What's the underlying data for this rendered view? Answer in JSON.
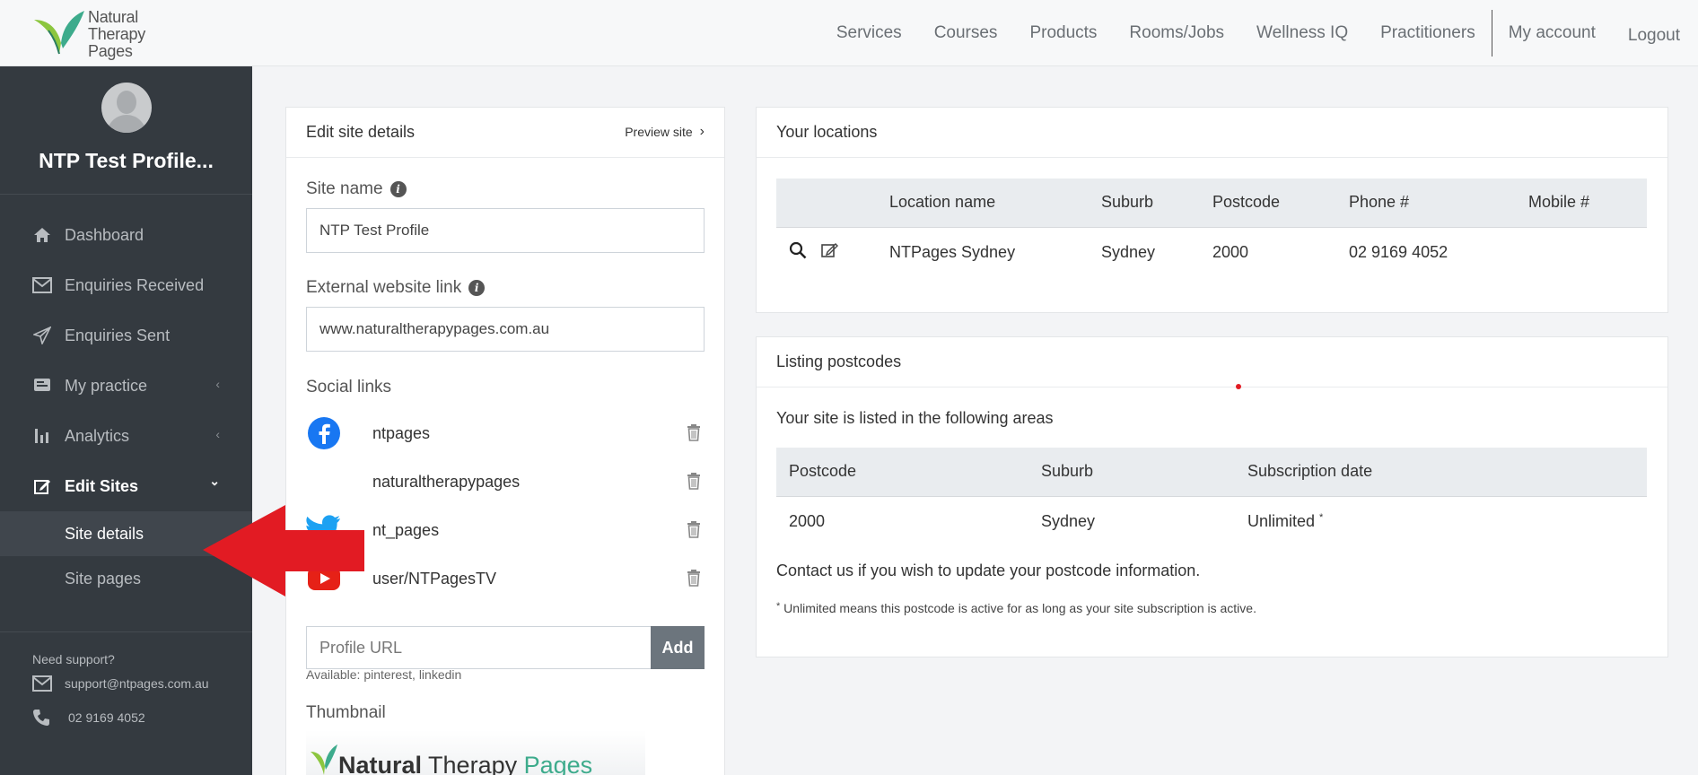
{
  "brand": {
    "logo_line1": "Natural",
    "logo_line2": "Therapy",
    "logo_line3": "Pages",
    "accent": "#3dab8c"
  },
  "nav": {
    "items": [
      "Services",
      "Courses",
      "Products",
      "Rooms/Jobs",
      "Wellness IQ",
      "Practitioners"
    ],
    "account": "My account",
    "logout": "Logout"
  },
  "sidebar": {
    "profile_name": "NTP Test Profile...",
    "items": [
      {
        "label": "Dashboard",
        "icon": "home-icon"
      },
      {
        "label": "Enquiries Received",
        "icon": "mail-icon"
      },
      {
        "label": "Enquiries Sent",
        "icon": "send-icon"
      },
      {
        "label": "My practice",
        "icon": "practice-icon",
        "chevron": "‹"
      },
      {
        "label": "Analytics",
        "icon": "bar-chart-icon",
        "chevron": "‹"
      },
      {
        "label": "Edit Sites",
        "icon": "edit-icon",
        "chevron": "⌄"
      }
    ],
    "sub_items": [
      "Site details",
      "Site pages"
    ],
    "support": {
      "title": "Need support?",
      "email": "support@ntpages.com.au",
      "phone": "02 9169 4052"
    }
  },
  "edit_site": {
    "title": "Edit site details",
    "preview": "Preview site",
    "site_name_label": "Site name",
    "site_name_value": "NTP Test Profile",
    "external_label": "External website link",
    "external_value": "www.naturaltherapypages.com.au",
    "social_label": "Social links",
    "socials": [
      {
        "icon": "facebook-icon",
        "handle": "ntpages"
      },
      {
        "icon": "instagram-icon",
        "handle": "naturaltherapypages"
      },
      {
        "icon": "twitter-icon",
        "handle": "nt_pages"
      },
      {
        "icon": "youtube-icon",
        "handle": "user/NTPagesTV"
      }
    ],
    "profile_url_placeholder": "Profile URL",
    "add_label": "Add",
    "available": "Available: pinterest, linkedin",
    "thumbnail_label": "Thumbnail",
    "thumbnail_text_1": "Natural",
    "thumbnail_text_2": "Therapy",
    "thumbnail_text_3": "Pages"
  },
  "locations": {
    "title": "Your locations",
    "columns": [
      "",
      "Location name",
      "Suburb",
      "Postcode",
      "Phone #",
      "Mobile #"
    ],
    "rows": [
      {
        "name": "NTPages Sydney",
        "suburb": "Sydney",
        "postcode": "2000",
        "phone": "02 9169 4052",
        "mobile": ""
      }
    ]
  },
  "postcodes": {
    "title": "Listing postcodes",
    "intro": "Your site is listed in the following areas",
    "columns": [
      "Postcode",
      "Suburb",
      "Subscription date"
    ],
    "rows": [
      {
        "postcode": "2000",
        "suburb": "Sydney",
        "date": "Unlimited",
        "marker": "*"
      }
    ],
    "contact": "Contact us if you wish to update your postcode information.",
    "footnote_marker": "*",
    "footnote": " Unlimited means this postcode is active for as long as your site subscription is active."
  },
  "colors": {
    "sidebar": "#343a40",
    "highlight_arrow": "#e21b23",
    "button": "#6c757d"
  }
}
